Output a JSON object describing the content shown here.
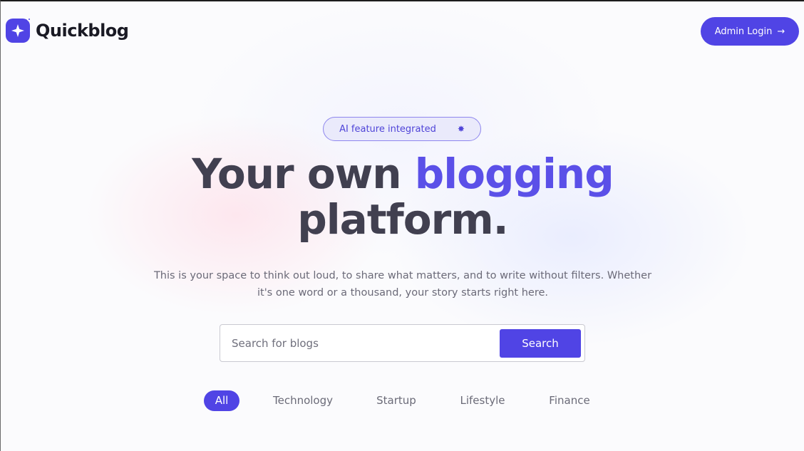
{
  "header": {
    "logo_text": "Quickblog",
    "logo_icon": "sparkle-icon",
    "admin_button_label": "Admin Login",
    "admin_button_icon": "arrow-right-icon"
  },
  "hero": {
    "badge_text": "AI feature integrated",
    "badge_icon": "star-icon",
    "headline_part1": "Your own",
    "headline_accent": "blogging",
    "headline_part2": "platform.",
    "subtitle": "This is your space to think out loud, to share what matters, and to write without filters. Whether it's one word or a thousand, your story starts right here."
  },
  "search": {
    "placeholder": "Search for blogs",
    "button_label": "Search"
  },
  "categories": {
    "items": [
      "All",
      "Technology",
      "Startup",
      "Lifestyle",
      "Finance"
    ],
    "selected": "All"
  },
  "colors": {
    "accent": "#5044e5",
    "heading": "#414050",
    "body_text": "#6b6a78"
  }
}
